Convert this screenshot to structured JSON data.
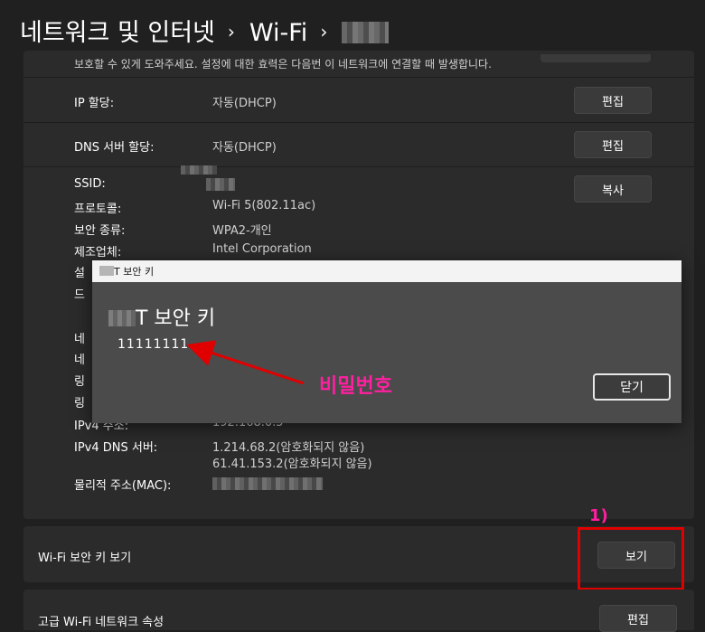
{
  "breadcrumb": {
    "root": "네트워크 및 인터넷",
    "separator": "›",
    "wifi": "Wi-Fi"
  },
  "top_note": "보호할 수 있게 도와주세요. 설정에 대한 효력은 다음번 이 네트워크에 연결할 때 발생합니다.",
  "ip_assignment": {
    "label": "IP 할당:",
    "value": "자동(DHCP)",
    "button": "편집"
  },
  "dns_assignment": {
    "label": "DNS 서버 할당:",
    "value": "자동(DHCP)",
    "button": "편집"
  },
  "properties": {
    "copy_button": "복사",
    "ssid_label": "SSID:",
    "protocol_label": "프로토콜:",
    "protocol_value": "Wi-Fi 5(802.11ac)",
    "security_label": "보안 종류:",
    "security_value": "WPA2-개인",
    "manufacturer_label": "제조업체:",
    "manufacturer_value": "Intel Corporation",
    "partial_label_1": "설",
    "partial_label_2": "드",
    "partial_label_3": "네",
    "partial_label_4": "네",
    "partial_label_5": "링",
    "partial_label_6": "링",
    "ipv4_label": "IPv4 주소:",
    "ipv4_value": "192.168.0.5",
    "ipv4_dns_label": "IPv4 DNS 서버:",
    "ipv4_dns_value_1": "1.214.68.2(암호화되지 않음)",
    "ipv4_dns_value_2": "61.41.153.2(암호화되지 않음)",
    "mac_label": "물리적 주소(MAC):"
  },
  "dialog": {
    "title": "T 보안 키",
    "heading": "T 보안 키",
    "key": "11111111",
    "close_button": "닫기"
  },
  "annotation": {
    "password_label": "비밀번호",
    "step_label": "1)",
    "color": "#ff1fa0",
    "box_color": "#e00000"
  },
  "wifi_security_key": {
    "label": "Wi-Fi 보안 키 보기",
    "button": "보기"
  },
  "advanced": {
    "label": "고급 Wi-Fi 네트워크 속성",
    "button": "편집"
  }
}
